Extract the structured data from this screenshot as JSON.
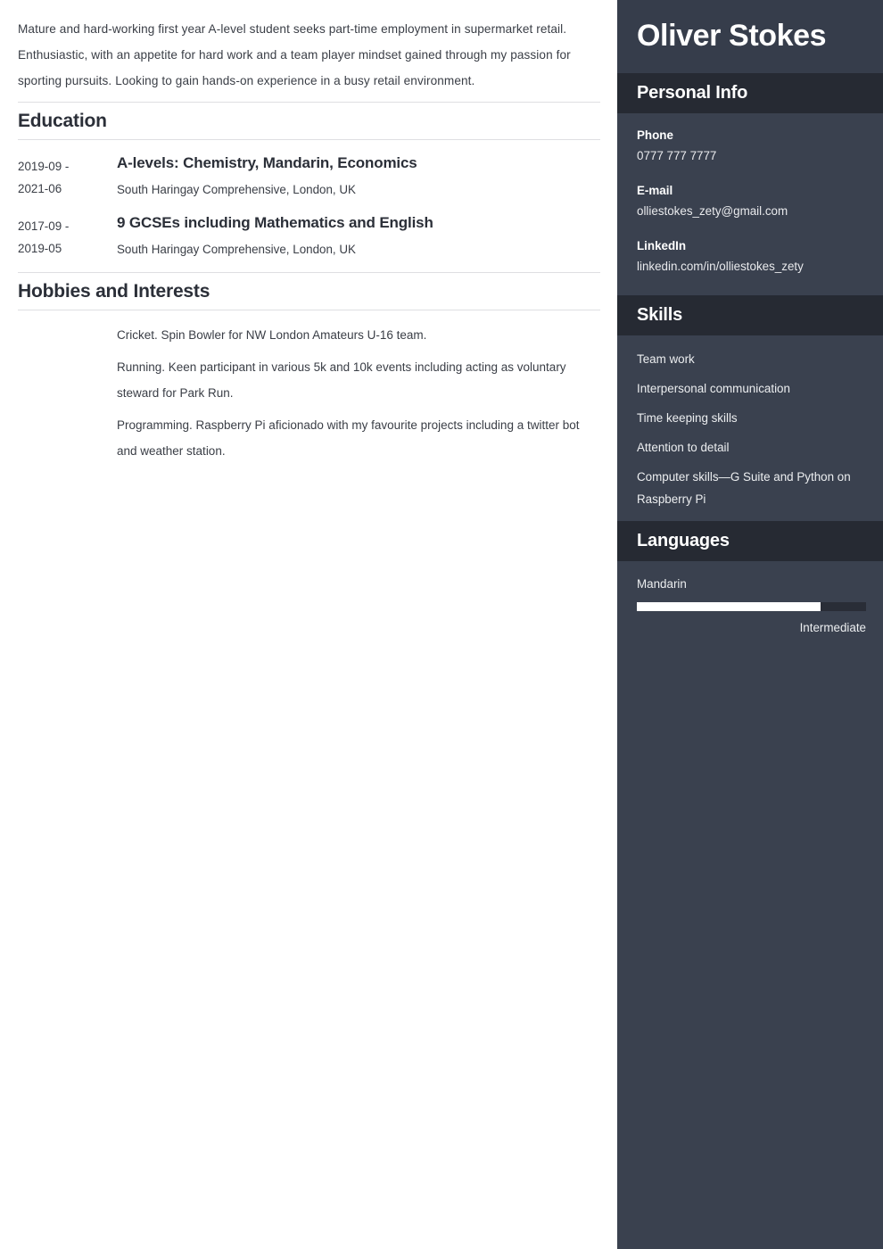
{
  "main": {
    "summary": "Mature and hard-working first year A-level student seeks part-time employment in supermarket retail. Enthusiastic, with an appetite for hard work and a team player mindset gained through my passion for sporting pursuits. Looking to gain hands-on experience in a busy retail environment.",
    "education": {
      "title": "Education",
      "entries": [
        {
          "date_start": "2019-09 -",
          "date_end": "2021-06",
          "title": "A-levels: Chemistry, Mandarin, Economics",
          "institution": "South Haringay Comprehensive, London, UK"
        },
        {
          "date_start": "2017-09 -",
          "date_end": "2019-05",
          "title": "9 GCSEs including Mathematics and English",
          "institution": "South Haringay Comprehensive, London, UK"
        }
      ]
    },
    "hobbies": {
      "title": "Hobbies and Interests",
      "items": [
        "Cricket. Spin Bowler for NW London Amateurs U-16 team.",
        "Running. Keen participant in various 5k and 10k events including acting as voluntary steward for Park Run.",
        "Programming. Raspberry Pi aficionado with my favourite projects including a twitter bot and weather station."
      ]
    }
  },
  "sidebar": {
    "name": "Oliver Stokes",
    "personal_info": {
      "title": "Personal Info",
      "items": [
        {
          "label": "Phone",
          "value": "0777 777 7777"
        },
        {
          "label": "E-mail",
          "value": "olliestokes_zety@gmail.com"
        },
        {
          "label": "LinkedIn",
          "value": "linkedin.com/in/olliestokes_zety"
        }
      ]
    },
    "skills": {
      "title": "Skills",
      "items": [
        "Team work",
        "Interpersonal communication",
        "Time keeping skills",
        "Attention to detail",
        "Computer skills—G Suite and Python on Raspberry Pi"
      ]
    },
    "languages": {
      "title": "Languages",
      "items": [
        {
          "name": "Mandarin",
          "level": "Intermediate",
          "percent": 80
        }
      ]
    }
  },
  "colors": {
    "sidebar_bg": "#3a414f",
    "sidebar_header_bg": "#363d4b",
    "sidebar_band_bg": "#262a33",
    "text_dark": "#2b2f38",
    "rule": "#dedfe2",
    "bar_fill": "#ffffff",
    "bar_track": "#292d37"
  }
}
